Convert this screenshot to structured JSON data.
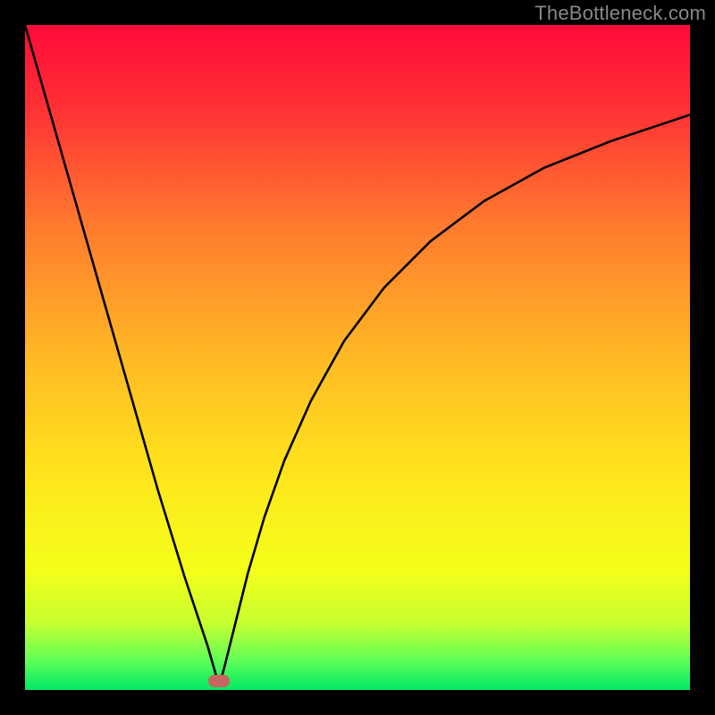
{
  "watermark": "TheBottleneck.com",
  "chart_data": {
    "type": "line",
    "title": "",
    "xlabel": "",
    "ylabel": "",
    "xlim": [
      0,
      100
    ],
    "ylim": [
      0,
      100
    ],
    "gradient_stops": [
      {
        "offset": 0.0,
        "color": "#ff0b3a"
      },
      {
        "offset": 0.12,
        "color": "#ff2f35"
      },
      {
        "offset": 0.3,
        "color": "#ff7a2e"
      },
      {
        "offset": 0.5,
        "color": "#ffb925"
      },
      {
        "offset": 0.68,
        "color": "#ffe61c"
      },
      {
        "offset": 0.82,
        "color": "#f4ff1a"
      },
      {
        "offset": 0.9,
        "color": "#c6ff30"
      },
      {
        "offset": 0.955,
        "color": "#62ff57"
      },
      {
        "offset": 1.0,
        "color": "#00e865"
      }
    ],
    "series": [
      {
        "name": "left-branch",
        "x": [
          0.0,
          2.0,
          4.0,
          6.0,
          8.0,
          10.0,
          12.0,
          14.0,
          16.0,
          18.0,
          20.0,
          22.0,
          24.0,
          26.0,
          27.5,
          28.5,
          29.2
        ],
        "y": [
          100.0,
          93.0,
          86.0,
          79.0,
          72.0,
          65.0,
          58.0,
          51.0,
          44.0,
          37.0,
          30.0,
          23.5,
          17.0,
          11.0,
          6.5,
          3.0,
          0.6
        ]
      },
      {
        "name": "right-branch",
        "x": [
          29.2,
          30.0,
          31.5,
          33.5,
          36.0,
          39.0,
          43.0,
          48.0,
          54.0,
          61.0,
          69.0,
          78.0,
          88.0,
          100.0
        ],
        "y": [
          0.6,
          3.5,
          9.5,
          17.5,
          26.0,
          34.5,
          43.5,
          52.5,
          60.5,
          67.5,
          73.5,
          78.5,
          82.5,
          86.5
        ]
      }
    ],
    "marker": {
      "x": 29.2,
      "y": 1.4,
      "color": "#c5665f"
    }
  }
}
